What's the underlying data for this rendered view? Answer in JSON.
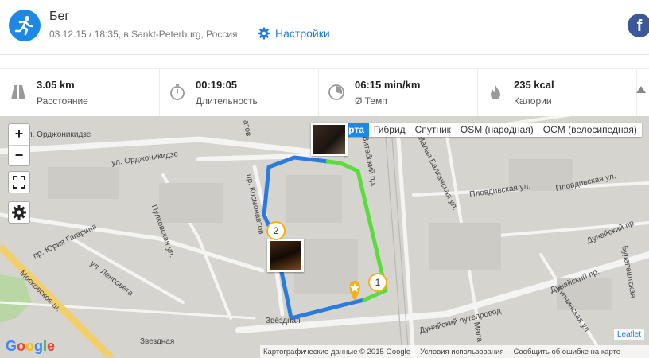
{
  "activity": {
    "title": "Бег",
    "subtitle": "03.12.15 / 18:35, в Sankt-Peterburg, Россия",
    "settings_label": "Настройки",
    "facebook_label": "f"
  },
  "stats": [
    {
      "value": "3.05 km",
      "label": "Расстояние",
      "icon": "road-icon"
    },
    {
      "value": "00:19:05",
      "label": "Длительность",
      "icon": "stopwatch-icon"
    },
    {
      "value": "06:15 min/km",
      "label": "Ø Темп",
      "icon": "pace-icon"
    },
    {
      "value": "235 kcal",
      "label": "Калории",
      "icon": "flame-icon"
    }
  ],
  "map": {
    "zoom_in": "+",
    "zoom_out": "−",
    "layers": [
      "Карта",
      "Гибрид",
      "Спутник",
      "OSM (народная)",
      "OCM (велосипедная)"
    ],
    "active_layer": "Карта",
    "google_logo": "Google",
    "attribution": [
      "Картографические данные © 2015 Google",
      "Условия использования",
      "Сообщить об ошибке на карте"
    ],
    "leaflet": "Leaflet",
    "marker_1": "1",
    "marker_2": "2",
    "street_labels": {
      "ordzhonikidze": "ул. Орджоникидзе",
      "ordzhonikidze_w": "ул. Орджоникидзе",
      "pulkovskaya": "Пулковская ул.",
      "kosmonavtov": "пр. Космонавтов",
      "yuriya_gagarina": "пр. Юрия Гагарина",
      "lensoveta": "ул. Ленсовета",
      "moskovskoe": "Московское ш.",
      "zvezdnaya_st": "Звездная",
      "zvezdnaya_ul": "Звёздная",
      "dunaysky_put": "Дунайский путепровод",
      "dunaysky_pr": "Дунайский пр.",
      "dunaysky_pr2": "Дунайский пр.",
      "plovdivskaya": "Пловдивская ул.",
      "plovdivskaya2": "Пловдивская ул.",
      "malaya_balkanskaya": "Малая Балканская ул.",
      "vitebsky": "Витебский пр.",
      "kupchinskaya": "Купчинская ул.",
      "budapeshtskaya": "Будапештская",
      "malaya": "Мала",
      "atov": "атов"
    }
  },
  "colors": {
    "accent": "#1e88e5",
    "route_blue": "#2a7bdf",
    "route_green": "#5cdc3c",
    "marker_border": "#f2b11a"
  }
}
